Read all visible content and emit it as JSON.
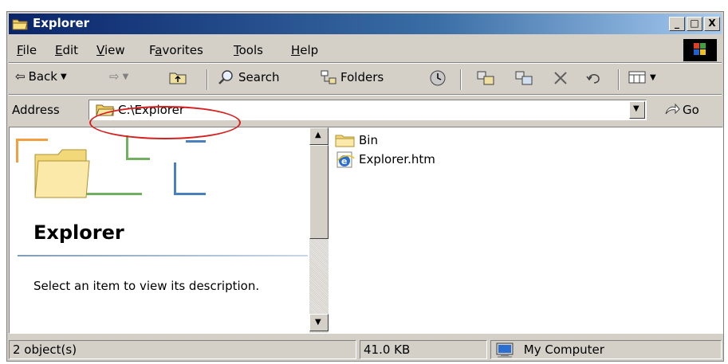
{
  "window": {
    "title": "Explorer",
    "title_gradient_start": "#0a246a",
    "title_gradient_end": "#a6caf0",
    "controls": [
      "_",
      "□",
      "X"
    ]
  },
  "menu": {
    "items": [
      {
        "label": "File",
        "accel": "F"
      },
      {
        "label": "Edit",
        "accel": "E"
      },
      {
        "label": "View",
        "accel": "V"
      },
      {
        "label": "Favorites",
        "accel": "a"
      },
      {
        "label": "Tools",
        "accel": "T"
      },
      {
        "label": "Help",
        "accel": "H"
      }
    ]
  },
  "toolbar": {
    "back_label": "Back",
    "search_label": "Search",
    "folders_label": "Folders"
  },
  "address": {
    "label": "Address",
    "value": "C:\\Explorer",
    "go_label": "Go"
  },
  "left_pane": {
    "title": "Explorer",
    "description": "Select an item to view its description."
  },
  "files": [
    {
      "name": "Bin",
      "icon": "folder-icon"
    },
    {
      "name": "Explorer.htm",
      "icon": "ie-html-icon"
    }
  ],
  "status": {
    "objects": "2 object(s)",
    "size": "41.0 KB",
    "zone": "My Computer"
  },
  "annotation_color": "#d62020"
}
